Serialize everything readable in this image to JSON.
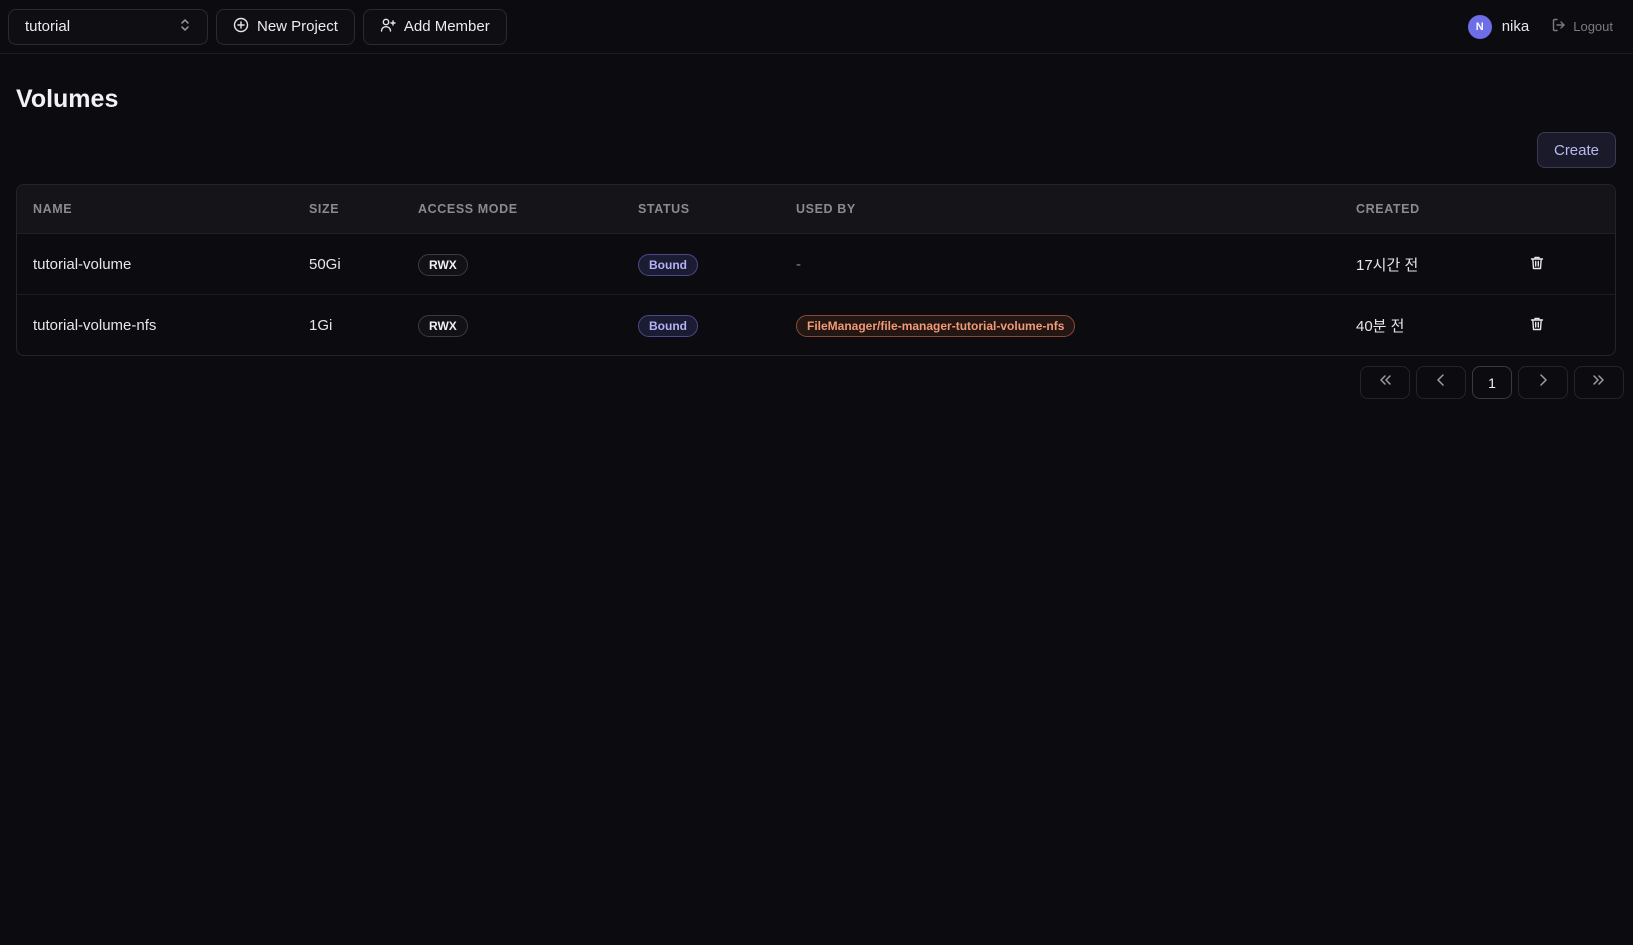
{
  "topbar": {
    "project_value": "tutorial",
    "new_project_label": "New Project",
    "add_member_label": "Add Member",
    "user_initial": "N",
    "user_name": "nika",
    "logout_label": "Logout"
  },
  "page": {
    "title": "Volumes",
    "create_label": "Create"
  },
  "table": {
    "columns": [
      "NAME",
      "SIZE",
      "ACCESS MODE",
      "STATUS",
      "USED BY",
      "CREATED"
    ],
    "rows": [
      {
        "name": "tutorial-volume",
        "size": "50Gi",
        "access": "RWX",
        "status": "Bound",
        "used_by": "-",
        "created": "17시간 전"
      },
      {
        "name": "tutorial-volume-nfs",
        "size": "1Gi",
        "access": "RWX",
        "status": "Bound",
        "used_by": "FileManager/file-manager-tutorial-volume-nfs",
        "created": "40분 전"
      }
    ]
  },
  "pagination": {
    "current_page": "1"
  },
  "colors": {
    "background": "#0c0c10",
    "accent": "#6e6ee8",
    "status_bound": "#b3b3f5",
    "used_by_badge": "#f09a78"
  }
}
